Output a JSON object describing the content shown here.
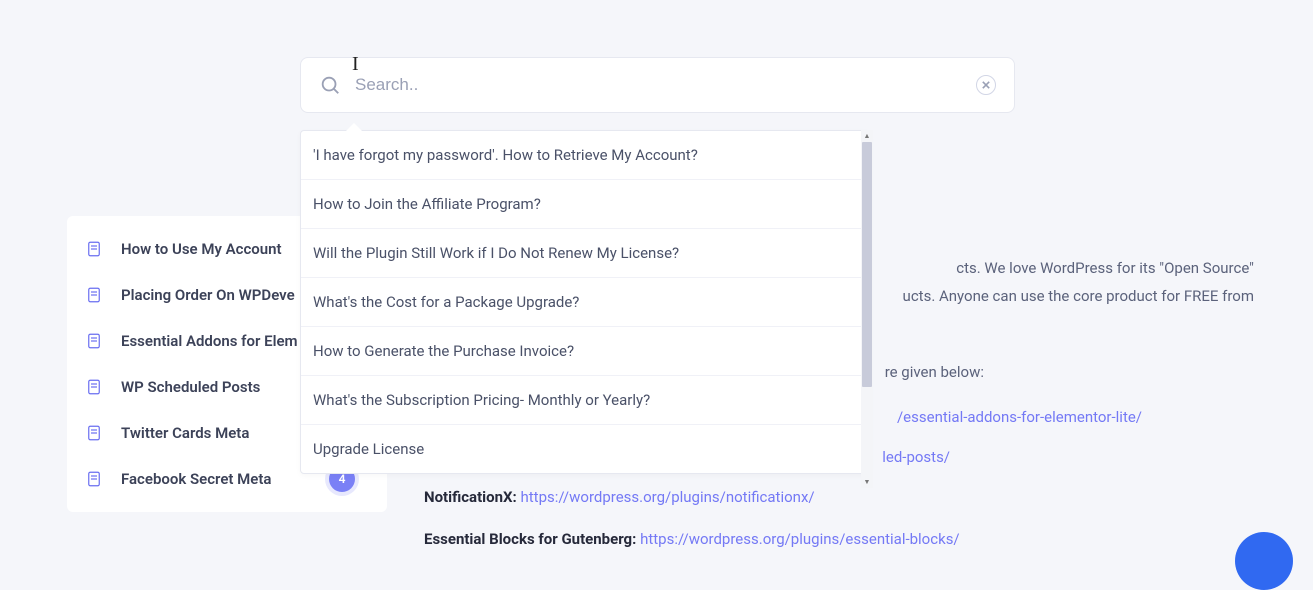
{
  "search": {
    "placeholder": "Search.."
  },
  "dropdown": {
    "items": [
      "'I have forgot my password'. How to Retrieve My Account?",
      "How to Join the Affiliate Program?",
      "Will the Plugin Still Work if I Do Not Renew My License?",
      "What's the Cost for a Package Upgrade?",
      "How to Generate the Purchase Invoice?",
      "What's the Subscription Pricing- Monthly or Yearly?",
      "Upgrade License"
    ]
  },
  "sidebar": {
    "items": [
      {
        "label": "How to Use My Account"
      },
      {
        "label": "Placing Order On WPDeve"
      },
      {
        "label": "Essential Addons for Elem"
      },
      {
        "label": "WP Scheduled Posts"
      },
      {
        "label": "Twitter Cards Meta"
      },
      {
        "label": "Facebook Secret Meta",
        "badge": "4"
      }
    ]
  },
  "content": {
    "intro_tail": "cts. We love WordPress for its \"Open Source\"",
    "intro_2": "ucts. Anyone can use the core product for FREE from",
    "given_below": "re given below:",
    "plugins": [
      {
        "name": "",
        "url": "/essential-addons-for-elementor-lite/"
      },
      {
        "name": "",
        "url": "led-posts/"
      },
      {
        "name": "NotificationX:",
        "url": "https://wordpress.org/plugins/notificationx/"
      },
      {
        "name": "Essential Blocks for Gutenberg:",
        "url": "https://wordpress.org/plugins/essential-blocks/"
      }
    ]
  }
}
